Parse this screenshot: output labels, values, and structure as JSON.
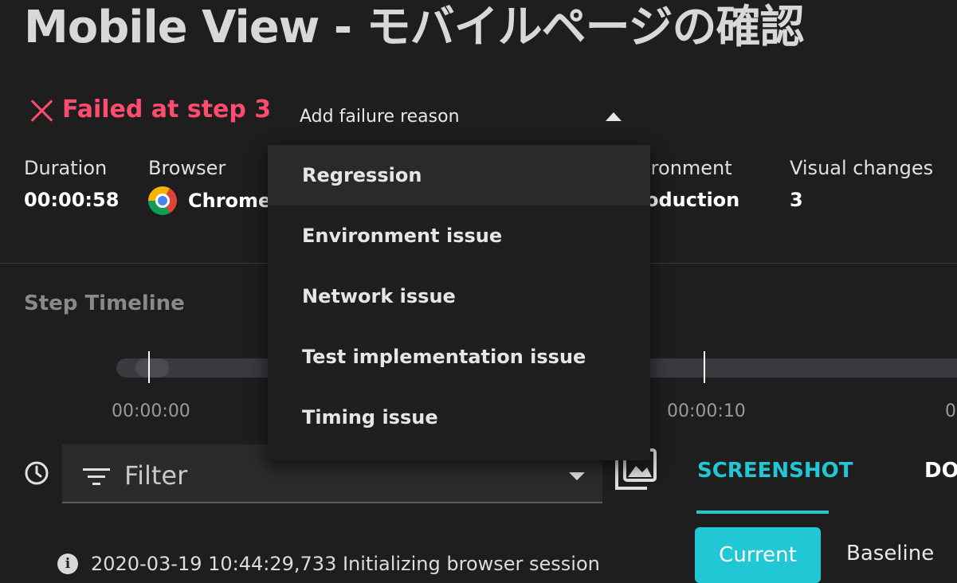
{
  "title": "Mobile View - モバイルページの確認",
  "status": {
    "text": "Failed at step 3",
    "color": "#ff4b6e"
  },
  "failure_reason_select": {
    "label": "Add failure reason",
    "options": [
      "Regression",
      "Environment issue",
      "Network issue",
      "Test implementation issue",
      "Timing issue"
    ],
    "highlighted_index": 0
  },
  "meta": {
    "duration": {
      "label": "Duration",
      "value": "00:00:58"
    },
    "browser": {
      "label": "Browser",
      "value": "Chrome",
      "icon": "chrome-icon"
    },
    "environment": {
      "label": "ironment",
      "value": "oduction"
    },
    "visual_changes": {
      "label": "Visual changes",
      "value": "3"
    }
  },
  "timeline": {
    "title": "Step Timeline",
    "ticks": [
      "00:00:00",
      "00:00:10",
      "0"
    ]
  },
  "filter": {
    "label": "Filter"
  },
  "tabs": {
    "screenshot": "SCREENSHOT",
    "dom": "DO"
  },
  "view_toggle": {
    "current": "Current",
    "baseline": "Baseline"
  },
  "log": {
    "line": "2020-03-19 10:44:29,733 Initializing browser session"
  },
  "colors": {
    "accent": "#22c7d6",
    "error": "#ff4b6e",
    "background": "#1e1e1f"
  }
}
